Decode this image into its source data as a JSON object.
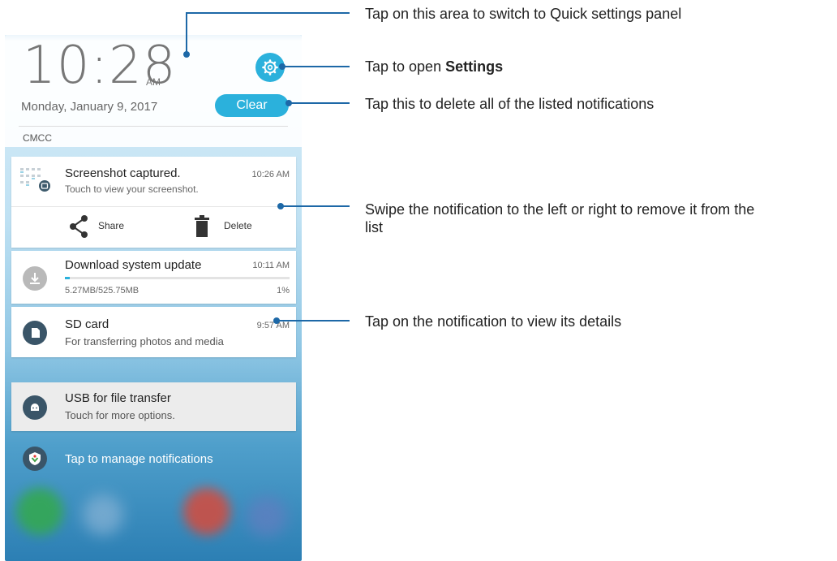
{
  "header": {
    "time": "10:28",
    "ampm": "AM",
    "date": "Monday, January 9, 2017",
    "clear_label": "Clear",
    "carrier": "CMCC"
  },
  "notifications": {
    "screenshot": {
      "title": "Screenshot captured.",
      "subtitle": "Touch to view your screenshot.",
      "time": "10:26 AM",
      "share_label": "Share",
      "delete_label": "Delete"
    },
    "download": {
      "title": "Download system update",
      "time": "10:11 AM",
      "size": "5.27MB/525.75MB",
      "percent_label": "1%",
      "progress": 1
    },
    "sd": {
      "title": "SD card",
      "subtitle": "For transferring photos and media",
      "time": "9:57 AM"
    },
    "usb": {
      "title": "USB for file transfer",
      "subtitle": "Touch for more options."
    },
    "manage_label": "Tap to manage notifications"
  },
  "callouts": {
    "quick_settings": "Tap on this area to switch to Quick settings panel",
    "settings_prefix": "Tap to open ",
    "settings_bold": "Settings",
    "clear": "Tap this to delete all of the listed notifications",
    "swipe_line1": "Swipe the notification to the left or right to remove it from the",
    "swipe_line2": "list",
    "details": "Tap on the notification to view its details"
  },
  "colors": {
    "accent": "#2bb1dc",
    "callout": "#1d68a7"
  }
}
